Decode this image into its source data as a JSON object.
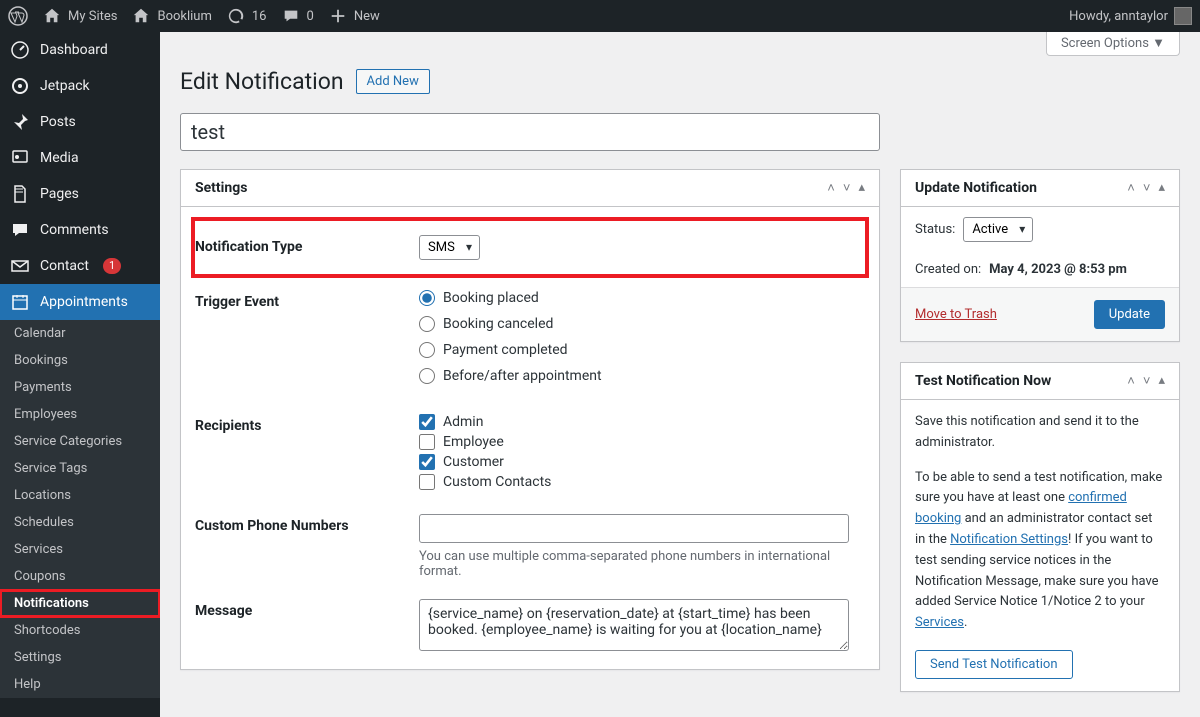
{
  "adminbar": {
    "mysites": "My Sites",
    "sitename": "Booklium",
    "updates_count": "16",
    "comments_count": "0",
    "new_label": "New",
    "howdy": "Howdy, anntaylor"
  },
  "sidebar": {
    "items": [
      {
        "id": "dashboard",
        "label": "Dashboard",
        "icon": "gauge"
      },
      {
        "id": "jetpack",
        "label": "Jetpack",
        "icon": "circle"
      },
      {
        "id": "posts",
        "label": "Posts",
        "icon": "pin"
      },
      {
        "id": "media",
        "label": "Media",
        "icon": "media"
      },
      {
        "id": "pages",
        "label": "Pages",
        "icon": "page"
      },
      {
        "id": "comments",
        "label": "Comments",
        "icon": "chat"
      },
      {
        "id": "contact",
        "label": "Contact",
        "icon": "mail",
        "badge": "1"
      },
      {
        "id": "appointments",
        "label": "Appointments",
        "icon": "calendar",
        "current": true
      }
    ],
    "sub": [
      "Calendar",
      "Bookings",
      "Payments",
      "Employees",
      "Service Categories",
      "Service Tags",
      "Locations",
      "Schedules",
      "Services",
      "Coupons",
      "Notifications",
      "Shortcodes",
      "Settings",
      "Help"
    ],
    "sub_active": "Notifications"
  },
  "page": {
    "screen_options": "Screen Options ▼",
    "title": "Edit Notification",
    "add_new": "Add New",
    "post_title": "test"
  },
  "settings_box": {
    "heading": "Settings",
    "fields": {
      "notification_type": {
        "label": "Notification Type",
        "value": "SMS"
      },
      "trigger": {
        "label": "Trigger Event",
        "options": [
          "Booking placed",
          "Booking canceled",
          "Payment completed",
          "Before/after appointment"
        ],
        "selected": "Booking placed"
      },
      "recipients": {
        "label": "Recipients",
        "options": [
          {
            "label": "Admin",
            "checked": true
          },
          {
            "label": "Employee",
            "checked": false
          },
          {
            "label": "Customer",
            "checked": true
          },
          {
            "label": "Custom Contacts",
            "checked": false
          }
        ]
      },
      "custom_phone": {
        "label": "Custom Phone Numbers",
        "value": "",
        "help": "You can use multiple comma-separated phone numbers in international format."
      },
      "message": {
        "label": "Message",
        "value": "{service_name} on {reservation_date} at {start_time} has been booked. {employee_name} is waiting for you at {location_name}"
      }
    }
  },
  "update_box": {
    "heading": "Update Notification",
    "status_label": "Status:",
    "status_value": "Active",
    "created_label": "Created on:",
    "created_value": "May 4, 2023 @ 8:53 pm",
    "trash": "Move to Trash",
    "update": "Update"
  },
  "test_box": {
    "heading": "Test Notification Now",
    "p1": "Save this notification and send it to the administrator.",
    "p2a": "To be able to send a test notification, make sure you have at least one ",
    "p2link1": "confirmed booking",
    "p2b": " and an administrator contact set in the ",
    "p2link2": "Notification Settings",
    "p2c": "! If you want to test sending service notices in the Notification Message, make sure you have added Service Notice 1/Notice 2 to your ",
    "p2link3": "Services",
    "p2d": ".",
    "button": "Send Test Notification"
  }
}
